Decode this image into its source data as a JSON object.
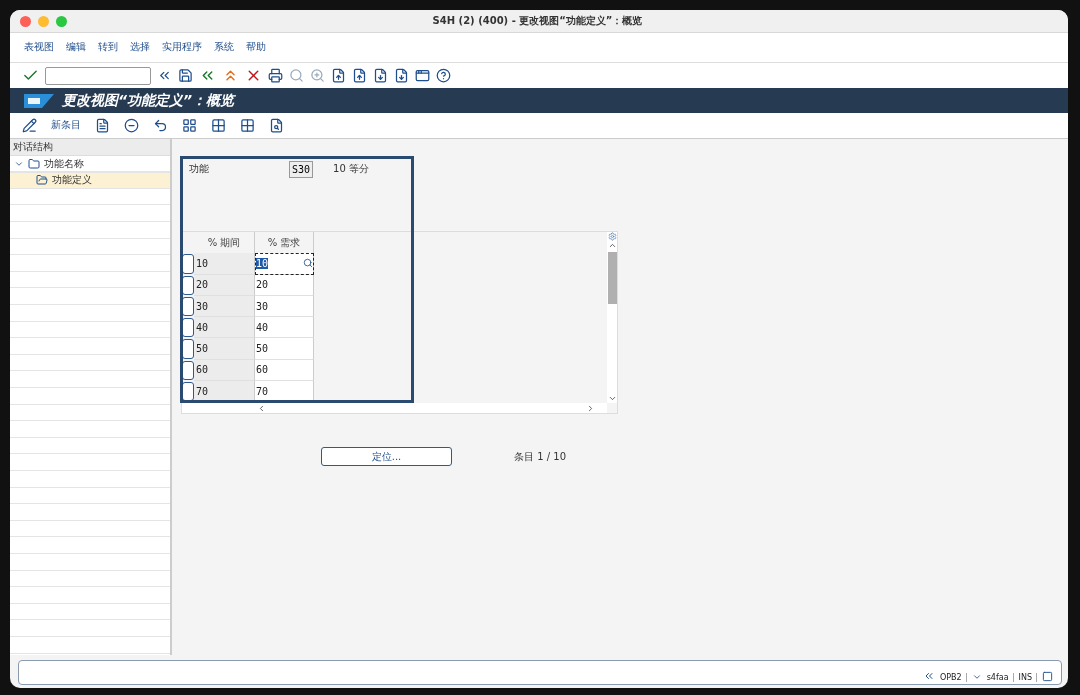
{
  "window": {
    "title": "S4H (2) (400) - 更改视图“功能定义”：概览"
  },
  "menu": [
    "表视图",
    "编辑",
    "转到",
    "选择",
    "实用程序",
    "系统",
    "帮助"
  ],
  "screen_title": "更改视图“功能定义”：概览",
  "app_toolbar": {
    "new_entries": "新条目"
  },
  "dialog_structure": {
    "title": "对话结构",
    "tree": [
      {
        "label": "功能名称",
        "expanded": true,
        "selected": false,
        "children": [
          {
            "label": "功能定义",
            "selected": true
          }
        ]
      }
    ]
  },
  "form": {
    "label": "功能",
    "key": "S30",
    "description": "10 等分"
  },
  "table": {
    "columns": [
      "% 期间",
      "% 需求"
    ],
    "rows": [
      {
        "period": "10",
        "demand": "10",
        "focused": true
      },
      {
        "period": "20",
        "demand": "20",
        "focused": false
      },
      {
        "period": "30",
        "demand": "30",
        "focused": false
      },
      {
        "period": "40",
        "demand": "40",
        "focused": false
      },
      {
        "period": "50",
        "demand": "50",
        "focused": false
      },
      {
        "period": "60",
        "demand": "60",
        "focused": false
      },
      {
        "period": "70",
        "demand": "70",
        "focused": false
      }
    ]
  },
  "position_button": "定位...",
  "entry_count": "条目 1 / 10",
  "status_bar": {
    "transaction": "OPB2",
    "server": "s4faa",
    "mode": "INS"
  }
}
